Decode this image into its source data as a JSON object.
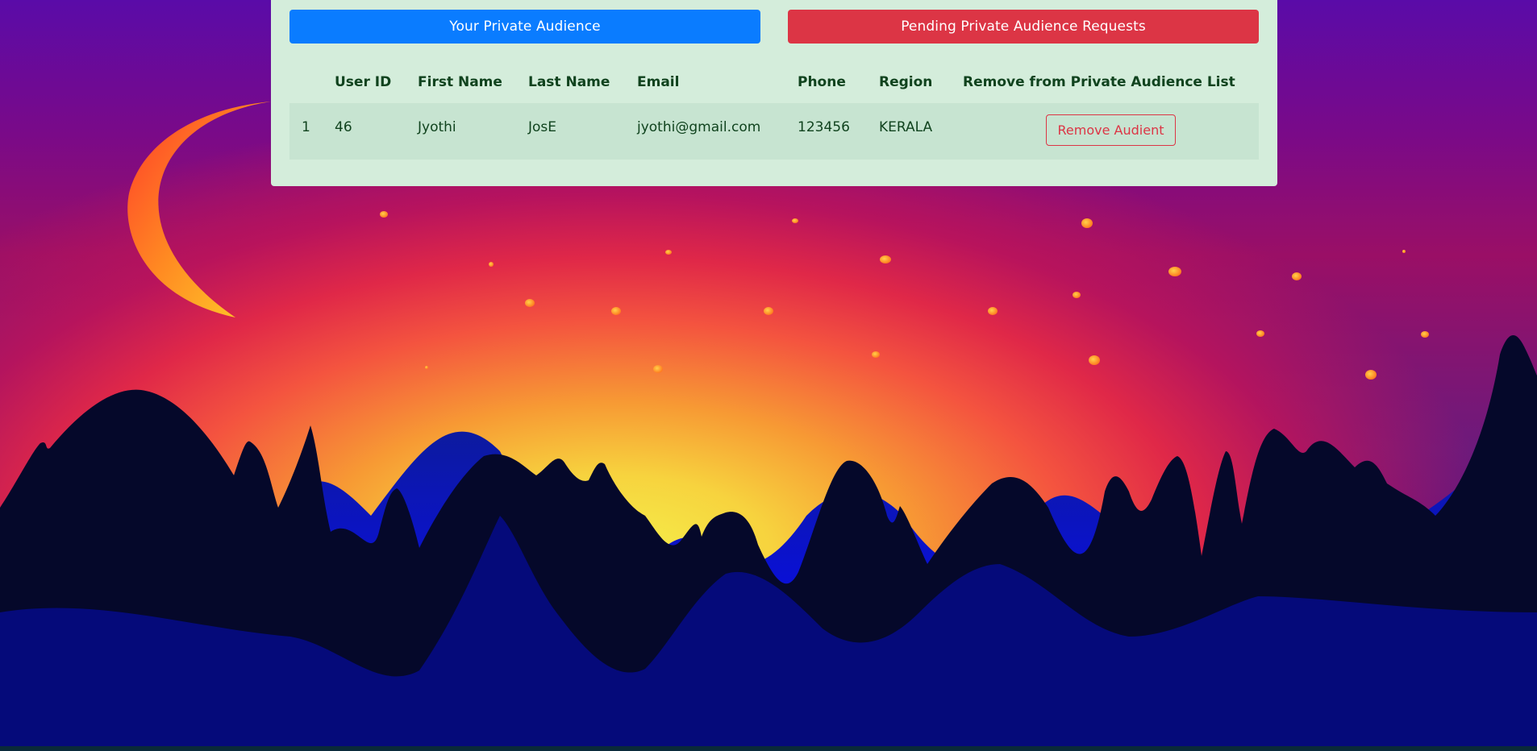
{
  "header_buttons": {
    "private_audience": "Your Private Audience",
    "pending_requests": "Pending Private Audience Requests"
  },
  "table": {
    "columns": [
      "",
      "User ID",
      "First Name",
      "Last Name",
      "Email",
      "Phone",
      "Region",
      "Remove from Private Audience List"
    ],
    "rows": [
      {
        "index": "1",
        "user_id": "46",
        "first_name": "Jyothi",
        "last_name": "JosE",
        "email": "jyothi@gmail.com",
        "phone": "123456",
        "region": "KERALA",
        "action_label": "Remove Audient"
      }
    ]
  },
  "colors": {
    "primary": "#0a7cff",
    "danger": "#dc3545",
    "panel": "#d4eddb",
    "text": "#10431e"
  },
  "background": {
    "decor": [
      "crescent-moon-icon",
      "stars",
      "mountains-silhouette"
    ]
  }
}
